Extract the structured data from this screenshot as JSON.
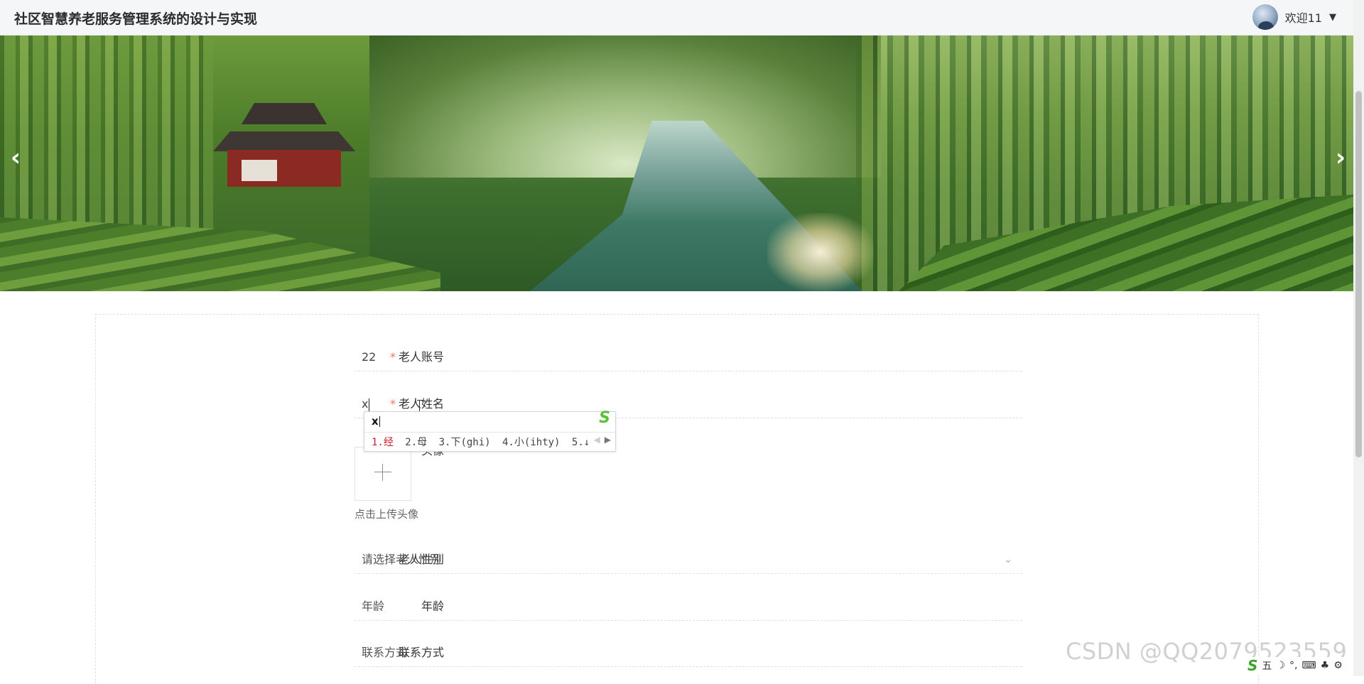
{
  "header": {
    "app_title": "社区智慧养老服务管理系统的设计与实现",
    "welcome_text": "欢迎11",
    "caret_icon": "caret-down-icon"
  },
  "banner": {
    "prev_icon": "chevron-left-icon",
    "next_icon": "chevron-right-icon",
    "prev_glyph": "‹",
    "next_glyph": "›",
    "slide_count": 3,
    "active_slide": 2
  },
  "form": {
    "account": {
      "label": "老人账号",
      "required": true,
      "value": "22"
    },
    "name": {
      "label": "老人姓名",
      "required": true,
      "value": "x"
    },
    "avatar": {
      "label": "头像",
      "hint": "点击上传头像"
    },
    "gender": {
      "label": "老人性别",
      "placeholder": "请选择老人性别"
    },
    "age": {
      "label": "年龄",
      "placeholder": "年龄"
    },
    "contact": {
      "label": "联系方式",
      "placeholder": "联系方式"
    }
  },
  "ime": {
    "composition": "x",
    "candidates": [
      "1.经",
      "2.母",
      "3.下(ghi)",
      "4.小(ihty)",
      "5.↓"
    ],
    "next_icon": "triangle-right-icon",
    "logo_glyph": "S"
  },
  "watermark": "CSDN @QQ2079523559",
  "tray": {
    "mode": "五",
    "items": [
      "☽",
      "°,",
      "⌨",
      "♣",
      "⚙"
    ]
  },
  "colors": {
    "required": "#f56c6c",
    "ime_first": "#c8202f",
    "ime_logo": "#5bbf3a"
  }
}
